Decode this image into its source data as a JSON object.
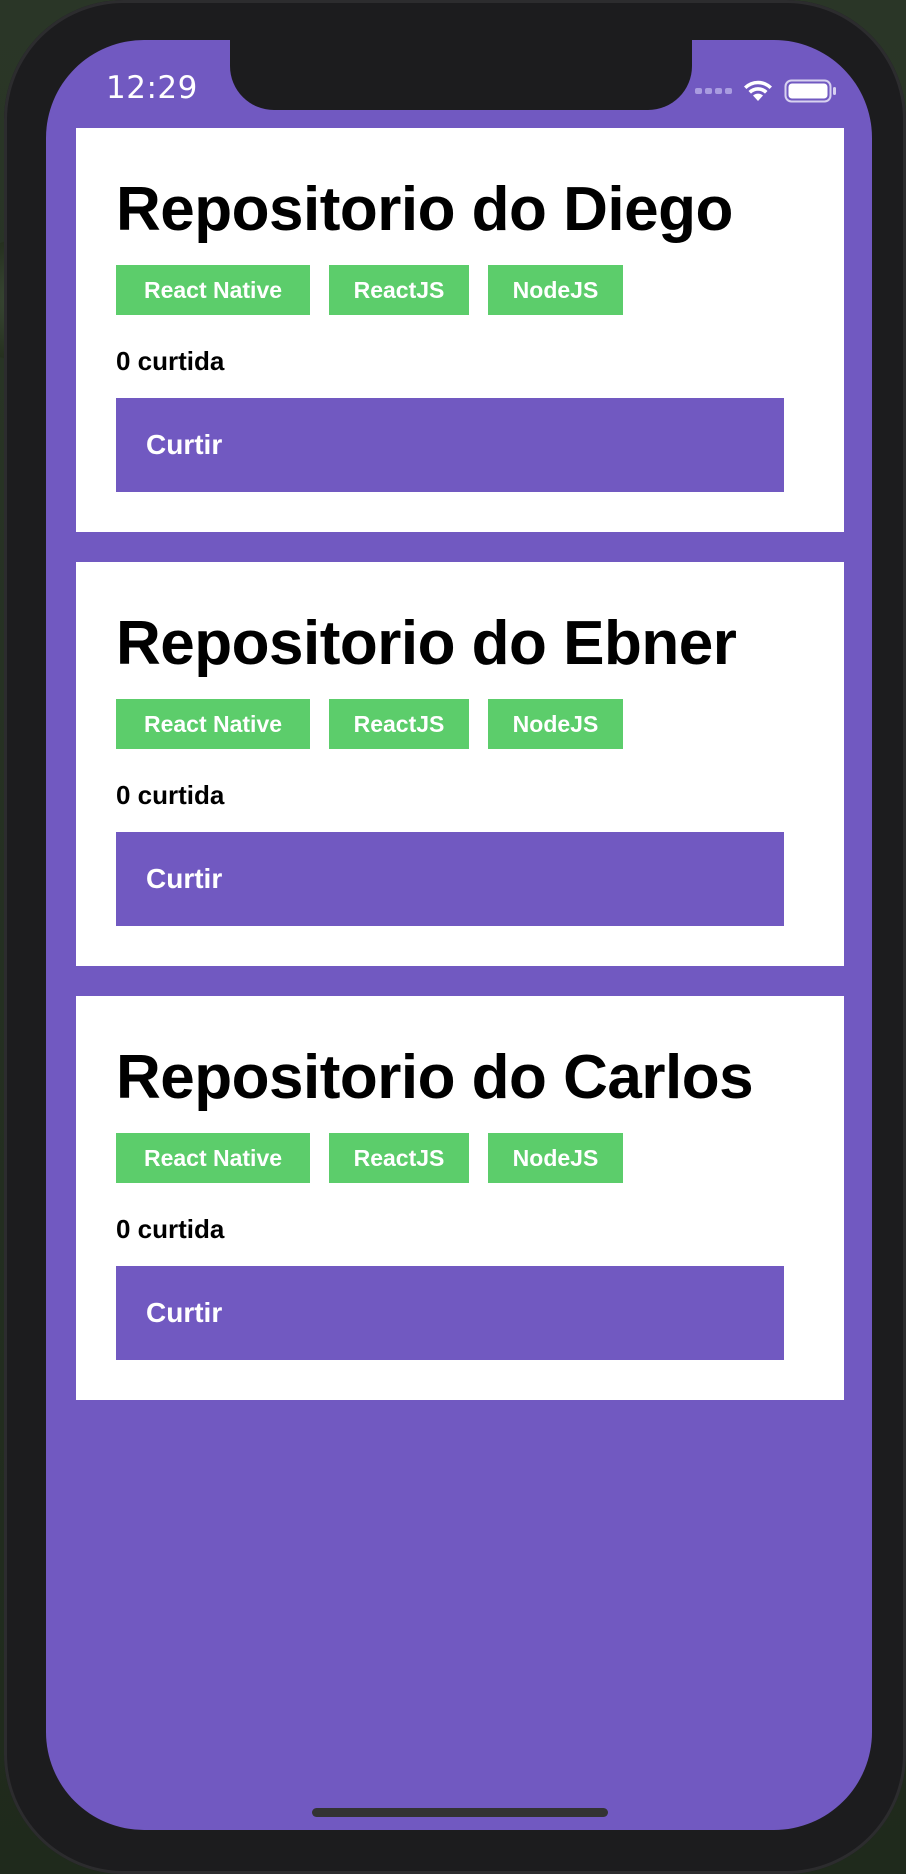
{
  "status_bar": {
    "time": "12:29",
    "icons": [
      "cellular-signal-icon",
      "wifi-icon",
      "battery-icon"
    ]
  },
  "colors": {
    "background": "#7159c1",
    "card": "#ffffff",
    "tech_badge": "#5ccd6b",
    "button": "#7159c1"
  },
  "repositories": [
    {
      "title": "Repositorio do Diego",
      "techs": [
        "React Native",
        "ReactJS",
        "NodeJS"
      ],
      "likes": "0 curtida",
      "like_button": "Curtir"
    },
    {
      "title": "Repositorio do Ebner",
      "techs": [
        "React Native",
        "ReactJS",
        "NodeJS"
      ],
      "likes": "0 curtida",
      "like_button": "Curtir"
    },
    {
      "title": "Repositorio do Carlos",
      "techs": [
        "React Native",
        "ReactJS",
        "NodeJS"
      ],
      "likes": "0 curtida",
      "like_button": "Curtir"
    }
  ]
}
